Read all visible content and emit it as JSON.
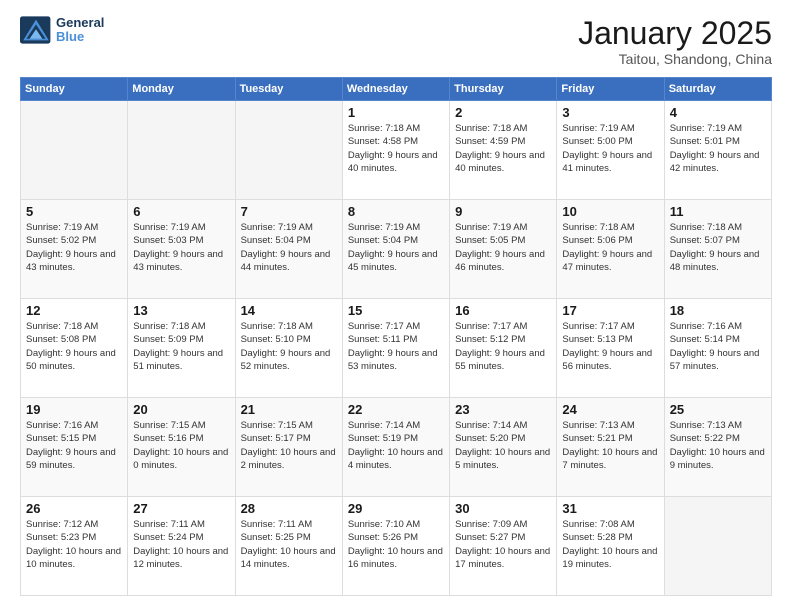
{
  "header": {
    "logo_general": "General",
    "logo_blue": "Blue",
    "title": "January 2025",
    "subtitle": "Taitou, Shandong, China"
  },
  "days_of_week": [
    "Sunday",
    "Monday",
    "Tuesday",
    "Wednesday",
    "Thursday",
    "Friday",
    "Saturday"
  ],
  "weeks": [
    {
      "days": [
        {
          "num": "",
          "empty": true
        },
        {
          "num": "",
          "empty": true
        },
        {
          "num": "",
          "empty": true
        },
        {
          "num": "1",
          "sunrise": "7:18 AM",
          "sunset": "4:58 PM",
          "daylight": "9 hours and 40 minutes."
        },
        {
          "num": "2",
          "sunrise": "7:18 AM",
          "sunset": "4:59 PM",
          "daylight": "9 hours and 40 minutes."
        },
        {
          "num": "3",
          "sunrise": "7:19 AM",
          "sunset": "5:00 PM",
          "daylight": "9 hours and 41 minutes."
        },
        {
          "num": "4",
          "sunrise": "7:19 AM",
          "sunset": "5:01 PM",
          "daylight": "9 hours and 42 minutes."
        }
      ]
    },
    {
      "days": [
        {
          "num": "5",
          "sunrise": "7:19 AM",
          "sunset": "5:02 PM",
          "daylight": "9 hours and 43 minutes."
        },
        {
          "num": "6",
          "sunrise": "7:19 AM",
          "sunset": "5:03 PM",
          "daylight": "9 hours and 43 minutes."
        },
        {
          "num": "7",
          "sunrise": "7:19 AM",
          "sunset": "5:04 PM",
          "daylight": "9 hours and 44 minutes."
        },
        {
          "num": "8",
          "sunrise": "7:19 AM",
          "sunset": "5:04 PM",
          "daylight": "9 hours and 45 minutes."
        },
        {
          "num": "9",
          "sunrise": "7:19 AM",
          "sunset": "5:05 PM",
          "daylight": "9 hours and 46 minutes."
        },
        {
          "num": "10",
          "sunrise": "7:18 AM",
          "sunset": "5:06 PM",
          "daylight": "9 hours and 47 minutes."
        },
        {
          "num": "11",
          "sunrise": "7:18 AM",
          "sunset": "5:07 PM",
          "daylight": "9 hours and 48 minutes."
        }
      ]
    },
    {
      "days": [
        {
          "num": "12",
          "sunrise": "7:18 AM",
          "sunset": "5:08 PM",
          "daylight": "9 hours and 50 minutes."
        },
        {
          "num": "13",
          "sunrise": "7:18 AM",
          "sunset": "5:09 PM",
          "daylight": "9 hours and 51 minutes."
        },
        {
          "num": "14",
          "sunrise": "7:18 AM",
          "sunset": "5:10 PM",
          "daylight": "9 hours and 52 minutes."
        },
        {
          "num": "15",
          "sunrise": "7:17 AM",
          "sunset": "5:11 PM",
          "daylight": "9 hours and 53 minutes."
        },
        {
          "num": "16",
          "sunrise": "7:17 AM",
          "sunset": "5:12 PM",
          "daylight": "9 hours and 55 minutes."
        },
        {
          "num": "17",
          "sunrise": "7:17 AM",
          "sunset": "5:13 PM",
          "daylight": "9 hours and 56 minutes."
        },
        {
          "num": "18",
          "sunrise": "7:16 AM",
          "sunset": "5:14 PM",
          "daylight": "9 hours and 57 minutes."
        }
      ]
    },
    {
      "days": [
        {
          "num": "19",
          "sunrise": "7:16 AM",
          "sunset": "5:15 PM",
          "daylight": "9 hours and 59 minutes."
        },
        {
          "num": "20",
          "sunrise": "7:15 AM",
          "sunset": "5:16 PM",
          "daylight": "10 hours and 0 minutes."
        },
        {
          "num": "21",
          "sunrise": "7:15 AM",
          "sunset": "5:17 PM",
          "daylight": "10 hours and 2 minutes."
        },
        {
          "num": "22",
          "sunrise": "7:14 AM",
          "sunset": "5:19 PM",
          "daylight": "10 hours and 4 minutes."
        },
        {
          "num": "23",
          "sunrise": "7:14 AM",
          "sunset": "5:20 PM",
          "daylight": "10 hours and 5 minutes."
        },
        {
          "num": "24",
          "sunrise": "7:13 AM",
          "sunset": "5:21 PM",
          "daylight": "10 hours and 7 minutes."
        },
        {
          "num": "25",
          "sunrise": "7:13 AM",
          "sunset": "5:22 PM",
          "daylight": "10 hours and 9 minutes."
        }
      ]
    },
    {
      "days": [
        {
          "num": "26",
          "sunrise": "7:12 AM",
          "sunset": "5:23 PM",
          "daylight": "10 hours and 10 minutes."
        },
        {
          "num": "27",
          "sunrise": "7:11 AM",
          "sunset": "5:24 PM",
          "daylight": "10 hours and 12 minutes."
        },
        {
          "num": "28",
          "sunrise": "7:11 AM",
          "sunset": "5:25 PM",
          "daylight": "10 hours and 14 minutes."
        },
        {
          "num": "29",
          "sunrise": "7:10 AM",
          "sunset": "5:26 PM",
          "daylight": "10 hours and 16 minutes."
        },
        {
          "num": "30",
          "sunrise": "7:09 AM",
          "sunset": "5:27 PM",
          "daylight": "10 hours and 17 minutes."
        },
        {
          "num": "31",
          "sunrise": "7:08 AM",
          "sunset": "5:28 PM",
          "daylight": "10 hours and 19 minutes."
        },
        {
          "num": "",
          "empty": true
        }
      ]
    }
  ]
}
